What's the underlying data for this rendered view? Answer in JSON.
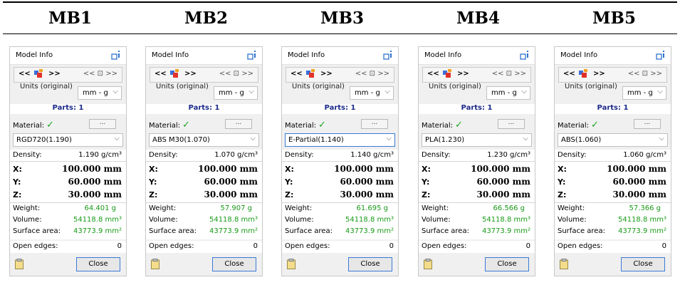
{
  "columns": [
    "MB1",
    "MB2",
    "MB3",
    "MB4",
    "MB5"
  ],
  "panel": {
    "title": "Model Info",
    "pin_icon": "pin-info-icon",
    "nav_left": "<<",
    "nav_right": ">>",
    "nav_group": "<<  ⊡  >>",
    "units_label": "Units (original)",
    "units_value": "mm - g",
    "parts_label": "Parts: 1",
    "material_label": "Material:",
    "material_check": "✓",
    "dots_label": "...",
    "density_label": "Density:",
    "x_label": "X:",
    "y_label": "Y:",
    "z_label": "Z:",
    "weight_label": "Weight:",
    "volume_label": "Volume:",
    "surface_label": "Surface area:",
    "open_edges_label": "Open edges:",
    "close_label": "Close"
  },
  "panels": [
    {
      "material": "RGD720(1.190)",
      "density": "1.190  g/cm³",
      "x": "100.000 mm",
      "y": "60.000 mm",
      "z": "30.000 mm",
      "weight": "64.401 g",
      "volume": "54118.8 mm³",
      "surface_area": "43773.9 mm²",
      "open_edges": "0",
      "focused": false
    },
    {
      "material": "ABS M30(1.070)",
      "density": "1.070  g/cm³",
      "x": "100.000 mm",
      "y": "60.000 mm",
      "z": "30.000 mm",
      "weight": "57.907 g",
      "volume": "54118.8 mm³",
      "surface_area": "43773.9 mm²",
      "open_edges": "0",
      "focused": false
    },
    {
      "material": "E-Partial(1.140)",
      "density": "1.140  g/cm³",
      "x": "100.000 mm",
      "y": "60.000 mm",
      "z": "30.000 mm",
      "weight": "61.695 g",
      "volume": "54118.8 mm³",
      "surface_area": "43773.9 mm²",
      "open_edges": "0",
      "focused": true
    },
    {
      "material": "PLA(1.230)",
      "density": "1.230  g/cm³",
      "x": "100.000 mm",
      "y": "60.000 mm",
      "z": "30.000 mm",
      "weight": "66.566 g",
      "volume": "54118.8 mm³",
      "surface_area": "43773.9 mm²",
      "open_edges": "0",
      "focused": false
    },
    {
      "material": "ABS(1.060)",
      "density": "1.060  g/cm³",
      "x": "100.000 mm",
      "y": "60.000 mm",
      "z": "30.000 mm",
      "weight": "57.366 g",
      "volume": "54118.8 mm³",
      "surface_area": "43773.9 mm²",
      "open_edges": "0",
      "focused": false
    }
  ]
}
